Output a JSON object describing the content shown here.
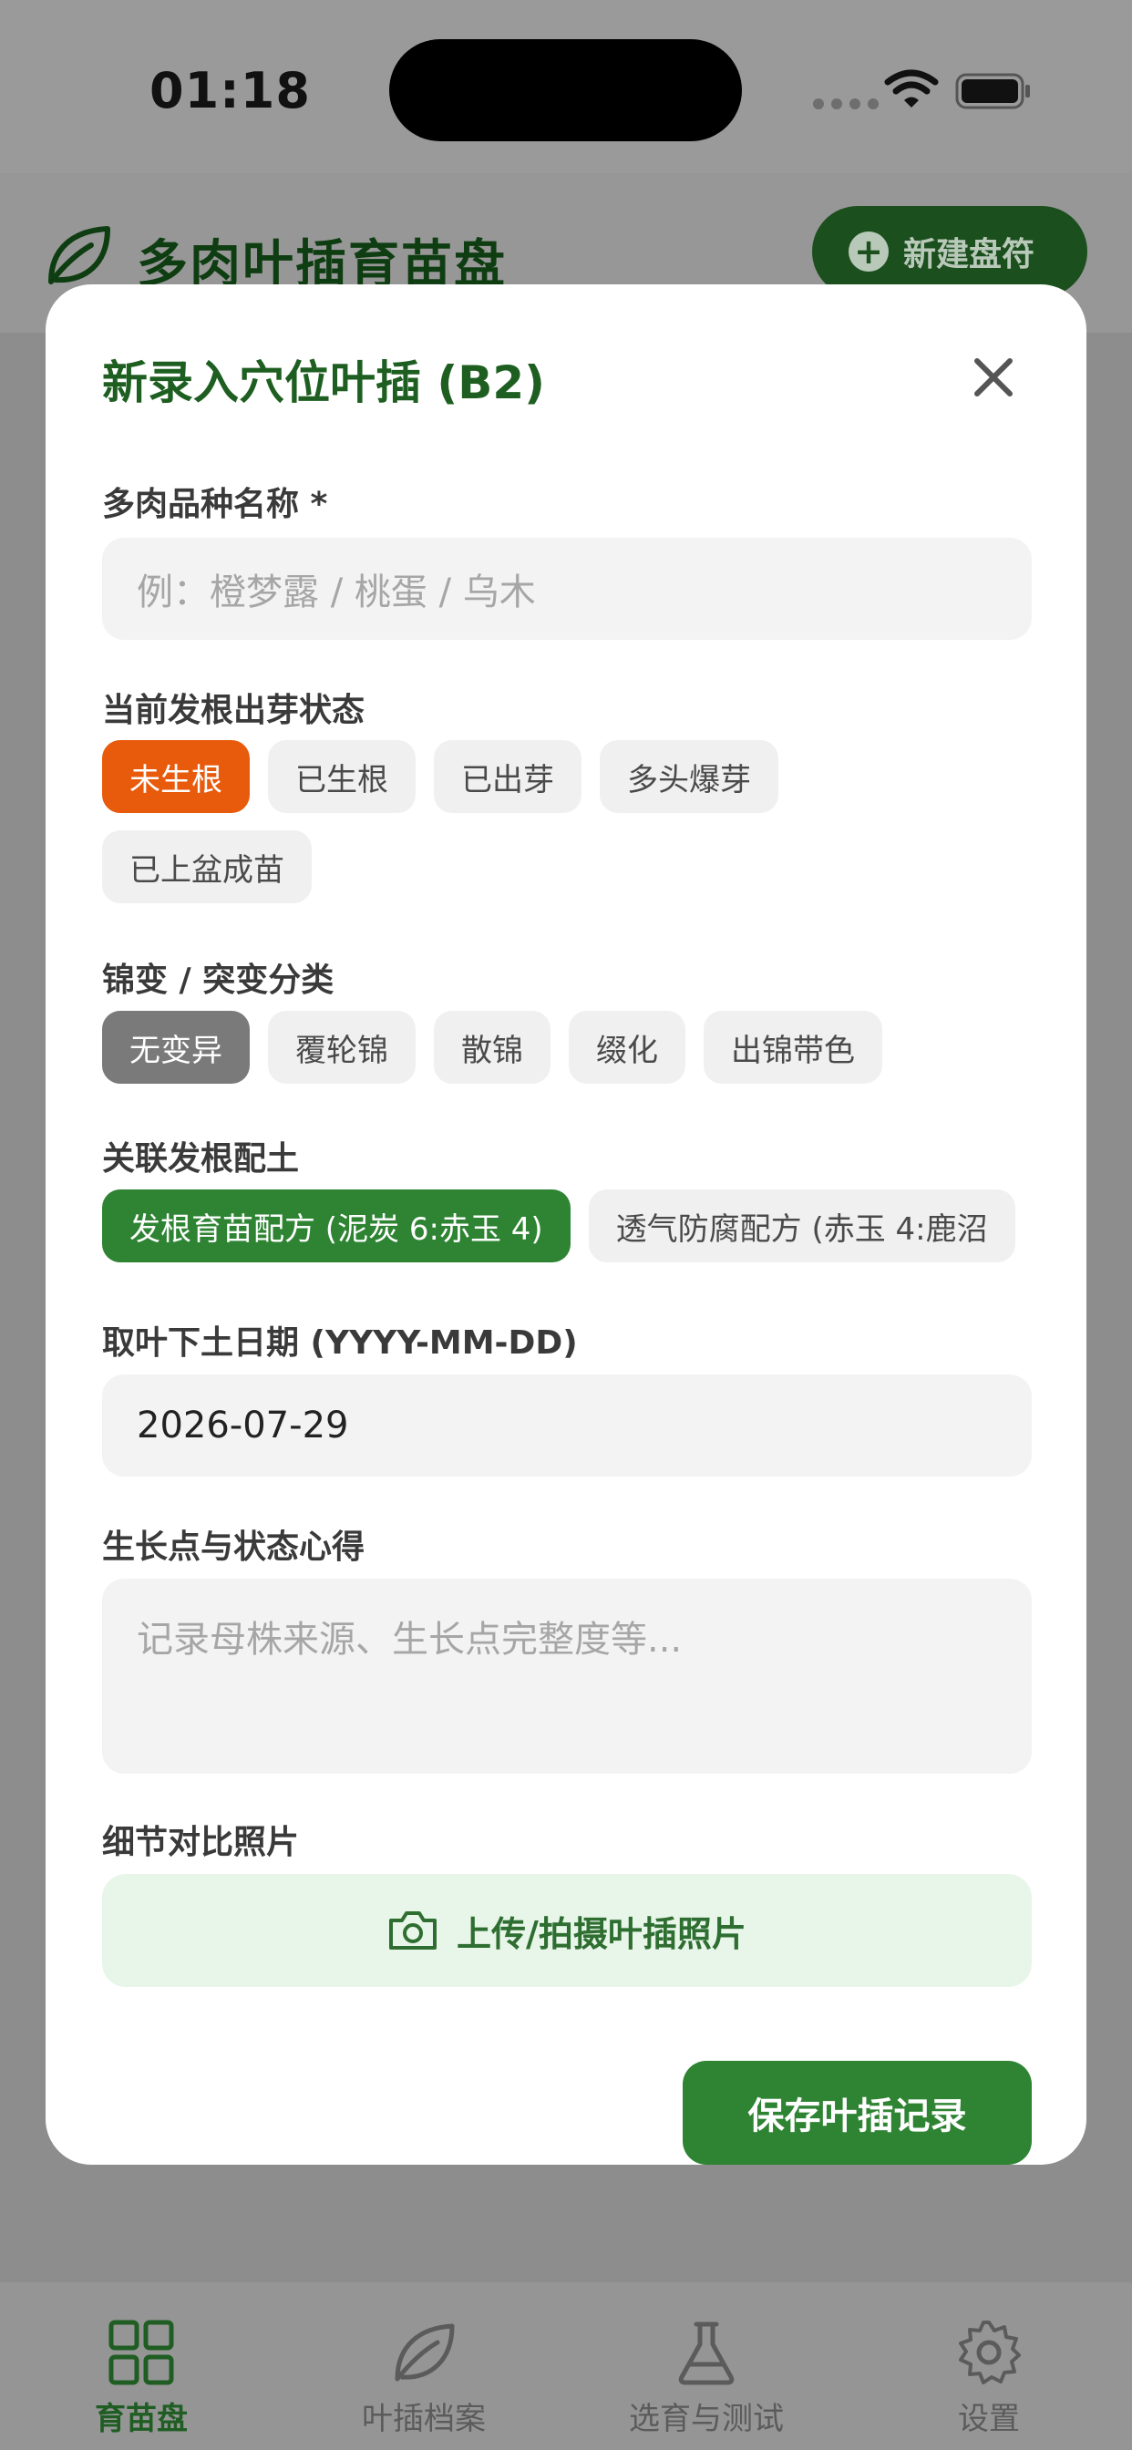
{
  "status_bar": {
    "time": "01:18"
  },
  "app": {
    "title": "多肉叶插育苗盘",
    "new_button_label": "新建盘符",
    "accent_color": "#2e8433"
  },
  "modal": {
    "title": "新录入穴位叶插 (B2)",
    "variety": {
      "label": "多肉品种名称 *",
      "value": "",
      "placeholder": "例：橙梦露 / 桃蛋 / 乌木"
    },
    "status": {
      "label": "当前发根出芽状态",
      "options": [
        "未生根",
        "已生根",
        "已出芽",
        "多头爆芽",
        "已上盆成苗"
      ],
      "selected": "未生根"
    },
    "variegation": {
      "label": "锦变 / 突变分类",
      "options": [
        "无变异",
        "覆轮锦",
        "散锦",
        "缀化",
        "出锦带色"
      ],
      "selected": "无变异"
    },
    "soil": {
      "label": "关联发根配土",
      "options": [
        "发根育苗配方 (泥炭 6:赤玉 4)",
        "透气防腐配方 (赤玉 4:鹿沼"
      ],
      "selected": "发根育苗配方 (泥炭 6:赤玉 4)"
    },
    "date": {
      "label": "取叶下土日期 (YYYY-MM-DD)",
      "value": "2026-07-29"
    },
    "notes": {
      "label": "生长点与状态心得",
      "value": "",
      "placeholder": "记录母株来源、生长点完整度等..."
    },
    "photo": {
      "label": "细节对比照片",
      "upload_label": "上传/拍摄叶插照片"
    },
    "save_label": "保存叶插记录"
  },
  "tabs": [
    {
      "label": "育苗盘",
      "icon": "grid-icon",
      "active": true
    },
    {
      "label": "叶插档案",
      "icon": "leaf-icon",
      "active": false
    },
    {
      "label": "选育与测试",
      "icon": "flask-icon",
      "active": false
    },
    {
      "label": "设置",
      "icon": "gear-icon",
      "active": false
    }
  ]
}
